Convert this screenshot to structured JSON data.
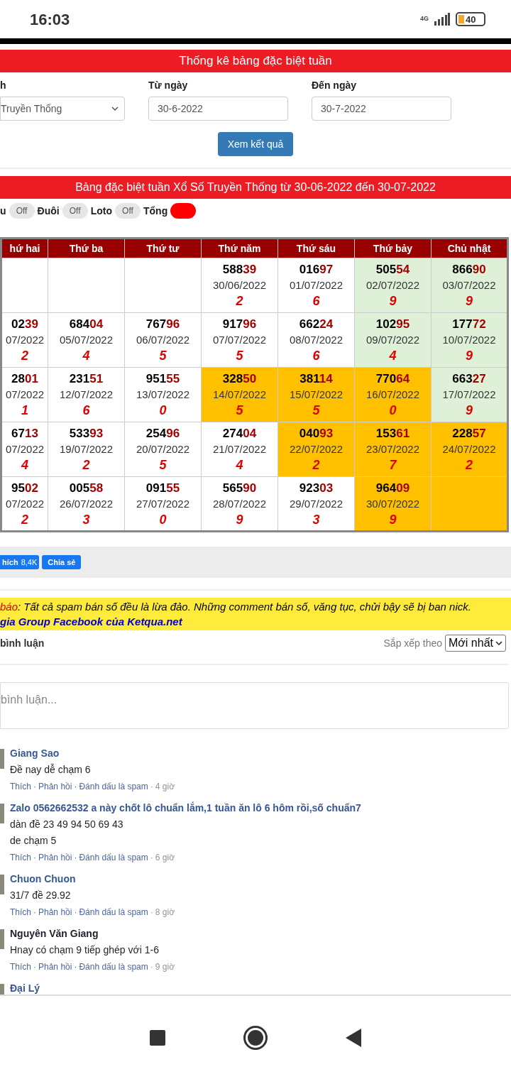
{
  "status_bar": {
    "time": "16:03",
    "network": "4G",
    "battery": "40"
  },
  "stats_form": {
    "title": "Thống kê bảng đặc biệt tuần",
    "fields": [
      {
        "kind": "select",
        "label": "h",
        "value": "Truyền Thống"
      },
      {
        "kind": "input",
        "label": "Từ ngày",
        "value": "30-6-2022"
      },
      {
        "kind": "input",
        "label": "Đến ngày",
        "value": "30-7-2022"
      }
    ],
    "submit": "Xem kết quả"
  },
  "results": {
    "title": "Bảng đặc biệt tuần Xổ Số Truyền Thống từ 30-06-2022 đến 30-07-2022",
    "toggles": [
      {
        "label": "u",
        "on": false,
        "state_text": "Off"
      },
      {
        "label": "Đuôi",
        "on": false,
        "state_text": "Off"
      },
      {
        "label": "Loto",
        "on": false,
        "state_text": "Off"
      },
      {
        "label": "Tổng",
        "on": true
      }
    ],
    "columns": [
      "hứ hai",
      "Thứ ba",
      "Thứ tư",
      "Thứ năm",
      "Thứ sáu",
      "Thứ bảy",
      "Chủ nhật"
    ],
    "rows": [
      [
        {
          "kind": "plain"
        },
        {
          "kind": "plain"
        },
        {
          "kind": "plain"
        },
        {
          "number": "58839",
          "date": "30/06/2022",
          "total": "2",
          "kind": "plain"
        },
        {
          "number": "01697",
          "date": "01/07/2022",
          "total": "6",
          "kind": "plain"
        },
        {
          "number": "50554",
          "date": "02/07/2022",
          "total": "9",
          "kind": "green"
        },
        {
          "number": "86690",
          "date": "03/07/2022",
          "total": "9",
          "kind": "green"
        }
      ],
      [
        {
          "number": "0239",
          "date": "07/2022",
          "total": "2",
          "kind": "plain"
        },
        {
          "number": "68404",
          "date": "05/07/2022",
          "total": "4",
          "kind": "plain"
        },
        {
          "number": "76796",
          "date": "06/07/2022",
          "total": "5",
          "kind": "plain"
        },
        {
          "number": "91796",
          "date": "07/07/2022",
          "total": "5",
          "kind": "plain"
        },
        {
          "number": "66224",
          "date": "08/07/2022",
          "total": "6",
          "kind": "plain"
        },
        {
          "number": "10295",
          "date": "09/07/2022",
          "total": "4",
          "kind": "green"
        },
        {
          "number": "17772",
          "date": "10/07/2022",
          "total": "9",
          "kind": "green"
        }
      ],
      [
        {
          "number": "2801",
          "date": "07/2022",
          "total": "1",
          "kind": "plain"
        },
        {
          "number": "23151",
          "date": "12/07/2022",
          "total": "6",
          "kind": "plain"
        },
        {
          "number": "95155",
          "date": "13/07/2022",
          "total": "0",
          "kind": "plain"
        },
        {
          "number": "32850",
          "date": "14/07/2022",
          "total": "5",
          "kind": "orange"
        },
        {
          "number": "38114",
          "date": "15/07/2022",
          "total": "5",
          "kind": "orange"
        },
        {
          "number": "77064",
          "date": "16/07/2022",
          "total": "0",
          "kind": "orange"
        },
        {
          "number": "66327",
          "date": "17/07/2022",
          "total": "9",
          "kind": "green"
        }
      ],
      [
        {
          "number": "6713",
          "date": "07/2022",
          "total": "4",
          "kind": "plain"
        },
        {
          "number": "53393",
          "date": "19/07/2022",
          "total": "2",
          "kind": "plain"
        },
        {
          "number": "25496",
          "date": "20/07/2022",
          "total": "5",
          "kind": "plain"
        },
        {
          "number": "27404",
          "date": "21/07/2022",
          "total": "4",
          "kind": "plain"
        },
        {
          "number": "04093",
          "date": "22/07/2022",
          "total": "2",
          "kind": "orange"
        },
        {
          "number": "15361",
          "date": "23/07/2022",
          "total": "7",
          "kind": "orange"
        },
        {
          "number": "22857",
          "date": "24/07/2022",
          "total": "2",
          "kind": "orange"
        }
      ],
      [
        {
          "number": "9502",
          "date": "07/2022",
          "total": "2",
          "kind": "plain"
        },
        {
          "number": "00558",
          "date": "26/07/2022",
          "total": "3",
          "kind": "plain"
        },
        {
          "number": "09155",
          "date": "27/07/2022",
          "total": "0",
          "kind": "plain"
        },
        {
          "number": "56590",
          "date": "28/07/2022",
          "total": "9",
          "kind": "plain"
        },
        {
          "number": "92303",
          "date": "29/07/2022",
          "total": "3",
          "kind": "plain"
        },
        {
          "number": "96409",
          "date": "30/07/2022",
          "total": "9",
          "kind": "orange"
        },
        {
          "kind": "orange"
        }
      ]
    ]
  },
  "separator": "·",
  "social": {
    "like_label": "hích",
    "like_count": "8,4K",
    "share": "Chia sẻ"
  },
  "notice": {
    "warning_prefix": "báo",
    "warning_text": ": Tất cả spam bán số đều là lừa đảo. Những comment bán số, văng tục, chửi bậy sẽ bị ban nick.",
    "link": "gia Group Facebook của Ketqua.net"
  },
  "comments": {
    "title": "bình luận",
    "sort_label": "Sắp xếp theo",
    "sort_value": "Mới nhất",
    "placeholder": "bình luận...",
    "items": [
      {
        "name": "Giang Sao",
        "linked": true,
        "lines": [
          "Đề nay dễ chạm 6"
        ],
        "actions": [
          "Thích",
          "Phản hồi",
          "Đánh dấu là spam"
        ],
        "time": "4 giờ"
      },
      {
        "name": "Zalo 0562662532 a này chốt lô chuẩn lắm,1 tuần ăn lô 6 hôm rồi,số chuẩn7",
        "linked": true,
        "lines": [
          "dàn đề 23 49 94 50 69 43",
          "de chạm 5"
        ],
        "actions": [
          "Thích",
          "Phản hồi",
          "Đánh dấu là spam"
        ],
        "time": "6 giờ"
      },
      {
        "name": "Chuon Chuon",
        "linked": true,
        "lines": [
          "31/7 đề 29.92"
        ],
        "actions": [
          "Thích",
          "Phản hồi",
          "Đánh dấu là spam"
        ],
        "time": "8 giờ"
      },
      {
        "name": "Nguyên Văn Giang",
        "linked": false,
        "lines": [
          "Hnay có chạm 9 tiếp ghép với 1-6"
        ],
        "actions": [
          "Thích",
          "Phản hồi",
          "Đánh dấu là spam"
        ],
        "time": "9 giờ"
      },
      {
        "name": "Đại Lý",
        "linked": true
      }
    ]
  }
}
